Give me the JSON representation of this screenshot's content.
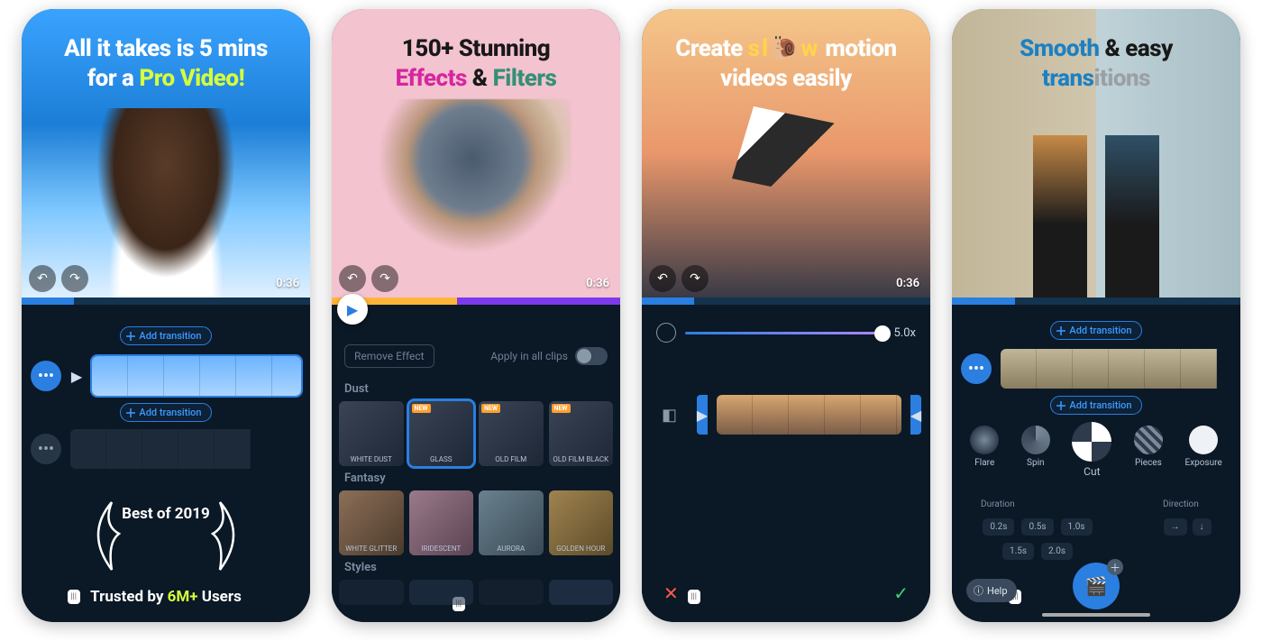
{
  "screens": {
    "s1": {
      "headline_pre": "All it takes is 5 mins",
      "headline_for": "for a ",
      "headline_accent": "Pro Video!",
      "timecode": "0:36",
      "add_transition": "Add transition",
      "award": "Best of 2019",
      "trusted_pre": "Trusted by ",
      "trusted_count": "6M+",
      "trusted_post": " Users"
    },
    "s2": {
      "headline_top": "150+ Stunning",
      "headline_effects": "Effects",
      "headline_amp": " & ",
      "headline_filters": "Filters",
      "remove_effect": "Remove Effect",
      "apply_all": "Apply in all clips",
      "sec_dust": "Dust",
      "sec_fantasy": "Fantasy",
      "sec_styles": "Styles",
      "dust_items": [
        "WHITE DUST",
        "GLASS",
        "OLD FILM",
        "OLD FILM BLACK"
      ],
      "fantasy_items": [
        "WHITE GLITTER",
        "IRIDESCENT",
        "AURORA",
        "GOLDEN HOUR"
      ],
      "new_badge": "NEW"
    },
    "s3": {
      "headline_l1_a": "Create ",
      "headline_l1_slow": "sl🐌w",
      "headline_l1_b": " motion",
      "headline_l2": "videos easily",
      "timecode": "0:36",
      "speed_value": "5.0x"
    },
    "s4": {
      "headline_smooth": "Smooth",
      "headline_easy": " & easy",
      "headline_trans": "trans",
      "headline_itions": "itions",
      "add_transition": "Add transition",
      "trans_items": [
        "Flare",
        "Spin",
        "Cut",
        "Pieces",
        "Exposure"
      ],
      "duration_label": "Duration",
      "direction_label": "Direction",
      "durations": [
        "0.2s",
        "0.5s",
        "1.0s",
        "1.5s",
        "2.0s"
      ],
      "help": "Help"
    }
  }
}
